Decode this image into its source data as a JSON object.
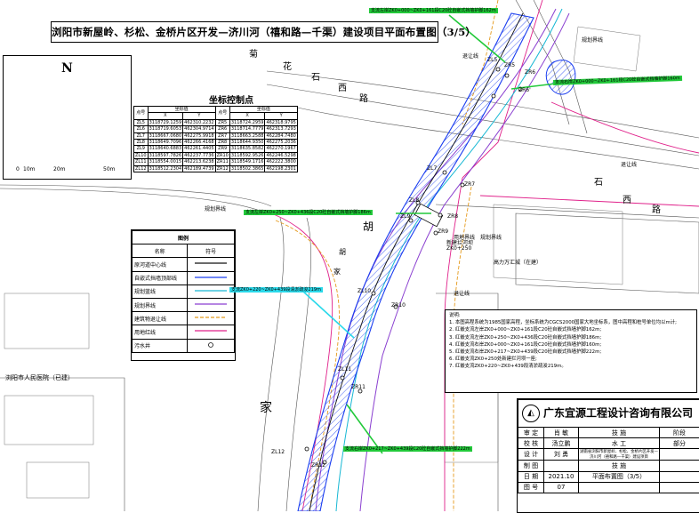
{
  "title": "浏阳市新屋岭、杉松、金桥片区开发—济川河（禧和路—千渠）建设项目平面布置图（3/5）",
  "north": {
    "letter": "N",
    "scale": [
      "0",
      "10m",
      "20m",
      "50m"
    ]
  },
  "coord_table": {
    "title": "坐标控制点",
    "headers": [
      "点号",
      "坐标值",
      "点号",
      "坐标值"
    ],
    "sub_headers": [
      "X",
      "Y",
      "X",
      "Y"
    ],
    "rows": [
      [
        "ZL5",
        "3118729.1259",
        "462310.2232",
        "ZR5",
        "3118724.2959",
        "462318.9795"
      ],
      [
        "ZL6",
        "3118719.6053",
        "462304.9714",
        "ZR6",
        "3118714.7779",
        "462313.7293"
      ],
      [
        "ZL7",
        "3118667.0680",
        "462275.9918",
        "ZR7",
        "3118663.2588",
        "462284.7480"
      ],
      [
        "ZL8",
        "3118649.7096",
        "462266.4168",
        "ZR8",
        "3118644.9350",
        "462275.2036"
      ],
      [
        "ZL9",
        "3118640.6883",
        "462261.4405",
        "ZR9",
        "3118635.8582",
        "462270.1967"
      ],
      [
        "ZL10",
        "3118597.7826",
        "462237.7736",
        "ZR10",
        "3118592.9526",
        "462246.5298"
      ],
      [
        "ZL11",
        "3118554.0015",
        "462213.6238",
        "ZR11",
        "3118549.1716",
        "462222.3800"
      ],
      [
        "ZL12",
        "3118512.2304",
        "462189.4739",
        "ZR12",
        "3118502.3865",
        "462198.2301"
      ]
    ]
  },
  "legend": {
    "title": "图例",
    "headers": [
      "名称",
      "符号"
    ],
    "items": [
      {
        "name": "原河道中心线",
        "color": "#111111",
        "style": "solid"
      },
      {
        "name": "自嵌式挡墙顶部线",
        "color": "#1a3df0",
        "style": "solid"
      },
      {
        "name": "规划蓝线",
        "color": "#18b8d4",
        "style": "solid"
      },
      {
        "name": "规划界线",
        "color": "#8a3fd0",
        "style": "solid"
      },
      {
        "name": "建筑物退让线",
        "color": "#e59a1c",
        "style": "dash"
      },
      {
        "name": "用地红线",
        "color": "#e0208a",
        "style": "solid"
      },
      {
        "name": "污水井",
        "color": "#111111",
        "style": "circle"
      }
    ]
  },
  "notes": {
    "heading": "说明:",
    "lines": [
      "1. 本图高程系统为1985国家高程，坐标系统为CGCS2000国家大地坐标系，图中高程和桩号单位均以m计;",
      "2. 红嵌支流左岸ZK0+000~ZK0+161段C20砼自嵌式挡墙护脚162m;",
      "3. 红嵌支流左岸ZK0+250~ZK0+436段C20砼自嵌式挡墙护脚186m;",
      "4. 红嵌支流右岸ZK0+000~ZK0+161段C20砼自嵌式挡墙护脚160m;",
      "5. 红嵌支流右岸ZK0+217~ZK0+439段C20砼自嵌式挡墙护脚222m;",
      "6. 红嵌支流ZK0+250处新建拦河坝一座;",
      "7. 红嵌支流ZK0+220~ZK0+439段清淤疏浚219m。"
    ]
  },
  "titleblock": {
    "company": "广东宜源工程设计咨询有限公司",
    "rows": [
      {
        "role": "审 定",
        "name": "肖 敏",
        "col3": "技 施",
        "col4": "阶段"
      },
      {
        "role": "校 核",
        "name": "汤立鹏",
        "col3": "水 工",
        "col4": "部分"
      },
      {
        "role": "设 计",
        "name": "刘 勇",
        "col3": "湖南省浏阳市新屋岭、杉松、金桥片区开发—济川河（禧和路—千渠）建设项目",
        "col4": ""
      },
      {
        "role": "制 图",
        "name": "",
        "col3": "技 施",
        "col4": ""
      },
      {
        "role": "日 期",
        "name": "2021.10",
        "col3": "平面布置图（3/5）",
        "col4": ""
      },
      {
        "role": "图 号",
        "name": "07",
        "col3": "",
        "col4": ""
      }
    ]
  },
  "annotations": {
    "a1": "支流左岸ZK0+000~ZK0+161段C20砼自嵌式挡墙护脚162m",
    "a2": "支流右岸ZK0+000~ZK0+161段C20砼自嵌式挡墙护脚160m",
    "a3": "支流左岸ZK0+250~ZK0+436段C20砼自嵌式挡墙护脚186m",
    "a4": "支流ZK0+220~ZK0+439段清淤疏浚219m",
    "a5": "支流右岸ZK0+217~ZK0+439段C20砼自嵌式挡墙护脚222m"
  },
  "map_labels": {
    "road_top": [
      "菊",
      "花",
      "石",
      "西",
      "路"
    ],
    "road_right": [
      "石",
      "西",
      "路"
    ],
    "road_vertical": [
      "胡",
      "家"
    ],
    "hu_small": "胡",
    "xiang_small": "家",
    "plan_boundary_1": "规划界线",
    "plan_boundary_2": "规划界线",
    "plan_boundary_3": "规划界线",
    "yield_1": "退让线",
    "yield_2": "退让线",
    "yield_3": "退让线",
    "land_line": "用地界线",
    "new_weir": "新建拦河坝",
    "weir_chainage": "ZK0+250",
    "gaoli": "高力万汇城（在建）",
    "hospital": "浏阳市人民医院（已建）",
    "bldg1": "",
    "zl5": "ZL5",
    "zr5": "ZR5",
    "zr6": "ZR6",
    "zr6b": "ZR6'",
    "zl7": "ZL7",
    "zr7": "ZR7",
    "zl8": "ZL8",
    "zr8": "ZR8",
    "zl9": "ZL9",
    "zr9": "ZR9",
    "zl10": "ZL10",
    "zr10": "ZR10",
    "zl11": "ZL11",
    "zr11": "ZR11",
    "zl12": "ZL12",
    "zr12": "ZR12"
  }
}
